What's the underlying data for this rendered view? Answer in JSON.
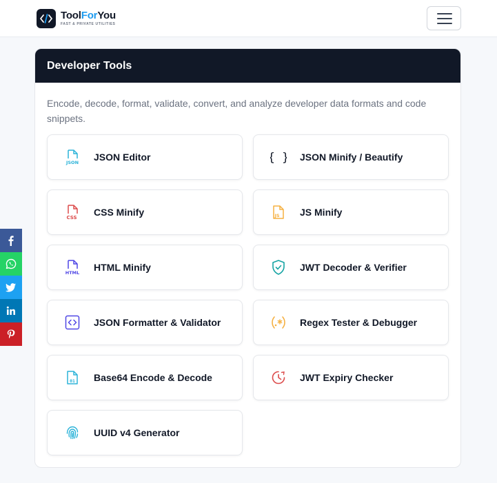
{
  "brand": {
    "name_part1": "Tool",
    "name_part2": "For",
    "name_part3": "You",
    "tagline": "FAST & PRIVATE UTILITIES"
  },
  "section": {
    "title": "Developer Tools",
    "description": "Encode, decode, format, validate, convert, and analyze developer data formats and code snippets."
  },
  "tools": [
    {
      "label": "JSON Editor",
      "icon": "json-file-icon",
      "color": "#2bb3d9"
    },
    {
      "label": "JSON Minify / Beautify",
      "icon": "curly-braces-icon",
      "color": "#111827"
    },
    {
      "label": "CSS Minify",
      "icon": "css-file-icon",
      "color": "#dc4a4a"
    },
    {
      "label": "JS Minify",
      "icon": "js-file-icon",
      "color": "#f5b041"
    },
    {
      "label": "HTML Minify",
      "icon": "html-file-icon",
      "color": "#4f46e5"
    },
    {
      "label": "JWT Decoder & Verifier",
      "icon": "shield-check-icon",
      "color": "#14a3a3"
    },
    {
      "label": "JSON Formatter & Validator",
      "icon": "code-brackets-icon",
      "color": "#4f46e5"
    },
    {
      "label": "Regex Tester & Debugger",
      "icon": "regex-icon",
      "color": "#f5b041"
    },
    {
      "label": "Base64 Encode & Decode",
      "icon": "binary-file-icon",
      "color": "#2bb3d9"
    },
    {
      "label": "JWT Expiry Checker",
      "icon": "clock-icon",
      "color": "#dc4a4a"
    },
    {
      "label": "UUID v4 Generator",
      "icon": "fingerprint-icon",
      "color": "#2bb3d9"
    }
  ],
  "share": [
    {
      "network": "facebook",
      "icon": "facebook-icon",
      "color": "#3b5998"
    },
    {
      "network": "whatsapp",
      "icon": "whatsapp-icon",
      "color": "#25d366"
    },
    {
      "network": "twitter",
      "icon": "twitter-icon",
      "color": "#1da1f2"
    },
    {
      "network": "linkedin",
      "icon": "linkedin-icon",
      "color": "#0077b5"
    },
    {
      "network": "pinterest",
      "icon": "pinterest-icon",
      "color": "#cb2027"
    }
  ]
}
